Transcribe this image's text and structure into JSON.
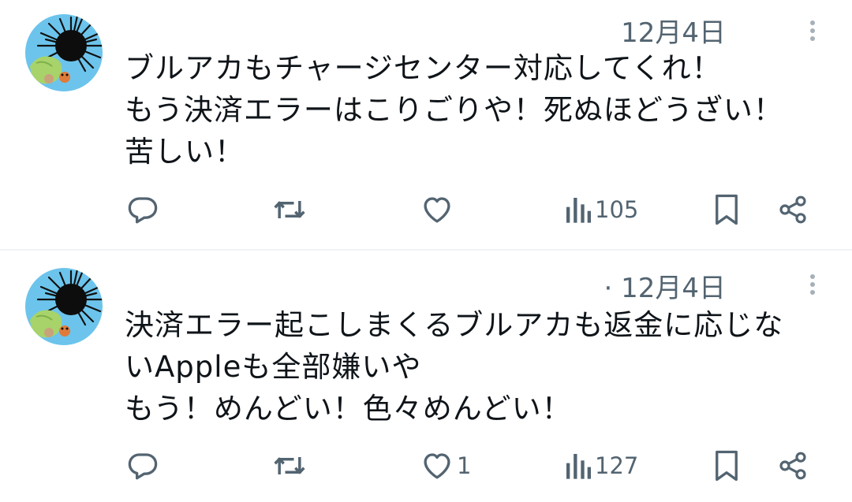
{
  "tweets": [
    {
      "author_name": "",
      "timestamp": "12月4日",
      "text_lines": [
        "ブルアカもチャージセンター対応してくれ！",
        "もう決済エラーはこりごりや！死ぬほどうざい！",
        "苦しい！"
      ],
      "reply_count": "",
      "retweet_count": "",
      "like_count": "",
      "view_count": "105",
      "icons": {
        "reply": "reply-icon",
        "retweet": "retweet-icon",
        "like": "heart-icon",
        "views": "analytics-icon",
        "bookmark": "bookmark-icon",
        "share": "share-icon",
        "more": "more-vertical-icon"
      }
    },
    {
      "author_name": "",
      "timestamp": "· 12月4日",
      "text_lines": [
        "決済エラー起こしまくるブルアカも返金に応じな",
        "いAppleも全部嫌いや",
        "もう！めんどい！色々めんどい！"
      ],
      "reply_count": "",
      "retweet_count": "",
      "like_count": "1",
      "view_count": "127",
      "icons": {
        "reply": "reply-icon",
        "retweet": "retweet-icon",
        "like": "heart-icon",
        "views": "analytics-icon",
        "bookmark": "bookmark-icon",
        "share": "share-icon",
        "more": "more-vertical-icon"
      }
    }
  ],
  "colors": {
    "text_primary": "#0f1419",
    "text_secondary": "#536471",
    "icon": "#536471",
    "divider": "#eff3f4",
    "avatar_bg": "#6cc4ec"
  }
}
